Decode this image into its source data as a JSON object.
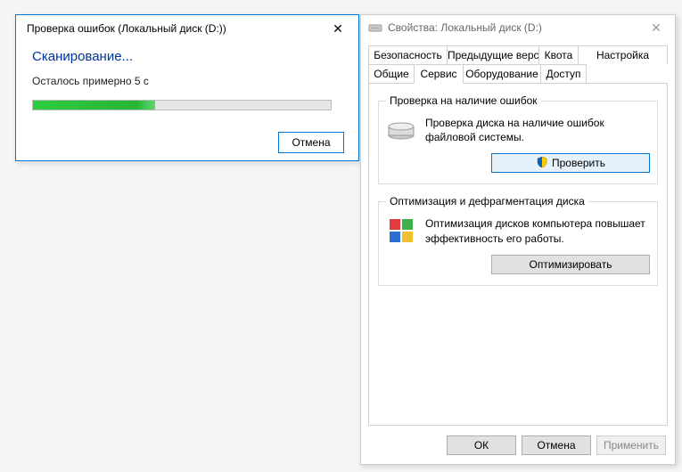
{
  "scan_dialog": {
    "title": "Проверка ошибок (Локальный диск (D:))",
    "heading": "Сканирование...",
    "status_text": "Осталось примерно 5 с",
    "progress_percent": 41,
    "cancel_label": "Отмена"
  },
  "props_window": {
    "title": "Свойства: Локальный диск (D:)",
    "tabs_row1": [
      {
        "label": "Безопасность"
      },
      {
        "label": "Предыдущие версии"
      },
      {
        "label": "Квота"
      },
      {
        "label": "Настройка"
      }
    ],
    "tabs_row2": [
      {
        "label": "Общие"
      },
      {
        "label": "Сервис",
        "active": true
      },
      {
        "label": "Оборудование"
      },
      {
        "label": "Доступ"
      }
    ],
    "errcheck": {
      "legend": "Проверка на наличие ошибок",
      "text": "Проверка диска на наличие ошибок файловой системы.",
      "button": "Проверить"
    },
    "defrag": {
      "legend": "Оптимизация и дефрагментация диска",
      "text": "Оптимизация дисков компьютера повышает эффективность его работы.",
      "button": "Оптимизировать"
    },
    "footer": {
      "ok": "ОК",
      "cancel": "Отмена",
      "apply": "Применить"
    }
  }
}
